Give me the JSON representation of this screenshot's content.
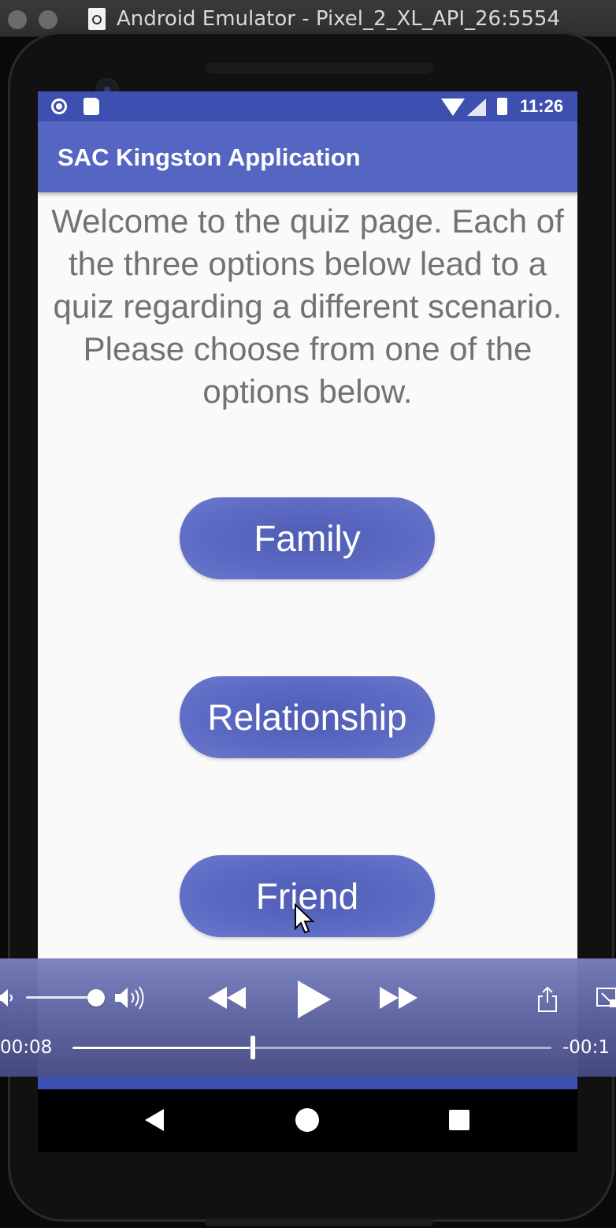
{
  "window": {
    "title": "Android Emulator - Pixel_2_XL_API_26:5554"
  },
  "status_bar": {
    "time": "11:26",
    "icons": [
      "sync-icon",
      "sd-card-icon",
      "wifi-icon",
      "cell-signal-icon",
      "battery-icon"
    ]
  },
  "app_bar": {
    "title": "SAC Kingston Application"
  },
  "main": {
    "welcome_text": "Welcome to the quiz page. Each of the three options below lead to a quiz regarding a different scenario. Please choose from one of the options below.",
    "buttons": [
      {
        "label": "Family"
      },
      {
        "label": "Relationship"
      },
      {
        "label": "Friend"
      }
    ]
  },
  "nav_bar": {
    "icons": [
      "back-icon",
      "home-icon",
      "recents-icon"
    ]
  },
  "player": {
    "elapsed": "00:08",
    "remaining": "-00:1",
    "progress": 0.37,
    "volume": 0.88
  },
  "colors": {
    "primary": "#5565c2",
    "primary_dark": "#3d4fb0",
    "button": "#5d6bc4",
    "background": "#fafafa",
    "body_text": "#727272"
  }
}
